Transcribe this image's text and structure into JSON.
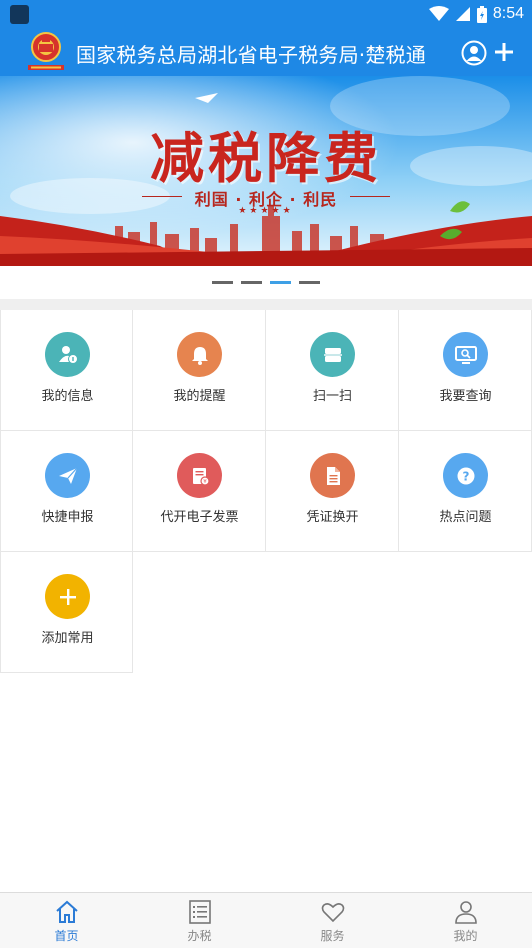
{
  "status_bar": {
    "time": "8:54"
  },
  "header": {
    "title": "国家税务总局湖北省电子税务局·楚税通",
    "icons": {
      "logo": "tax-emblem-icon",
      "user": "user-circle-icon",
      "add": "plus-icon"
    }
  },
  "banner": {
    "title": "减税降费",
    "subtitle": "利国 · 利企 · 利民",
    "stars": "★★★★★",
    "dots": {
      "count": 4,
      "active_index": 2
    }
  },
  "grid": {
    "items": [
      {
        "label": "我的信息",
        "icon": "person-info-icon",
        "color": "#4bb4b7"
      },
      {
        "label": "我的提醒",
        "icon": "bell-icon",
        "color": "#e6844f"
      },
      {
        "label": "扫一扫",
        "icon": "scan-icon",
        "color": "#4bb4b7"
      },
      {
        "label": "我要查询",
        "icon": "monitor-search-icon",
        "color": "#57a8ef"
      },
      {
        "label": "快捷申报",
        "icon": "paper-plane-icon",
        "color": "#57a8ef"
      },
      {
        "label": "代开电子发票",
        "icon": "invoice-icon",
        "color": "#e05b5b"
      },
      {
        "label": "凭证换开",
        "icon": "document-icon",
        "color": "#e0754f"
      },
      {
        "label": "热点问题",
        "icon": "question-icon",
        "color": "#57a8ef"
      },
      {
        "label": "添加常用",
        "icon": "plus-icon",
        "color": "#f2b300"
      }
    ]
  },
  "bottom_nav": {
    "items": [
      {
        "label": "首页",
        "icon": "home-icon",
        "active": true
      },
      {
        "label": "办税",
        "icon": "list-icon",
        "active": false
      },
      {
        "label": "服务",
        "icon": "heart-icon",
        "active": false
      },
      {
        "label": "我的",
        "icon": "person-icon",
        "active": false
      }
    ],
    "active_color": "#2b7bd6"
  },
  "colors": {
    "primary": "#1e88e5",
    "banner_red": "#c9251e"
  }
}
